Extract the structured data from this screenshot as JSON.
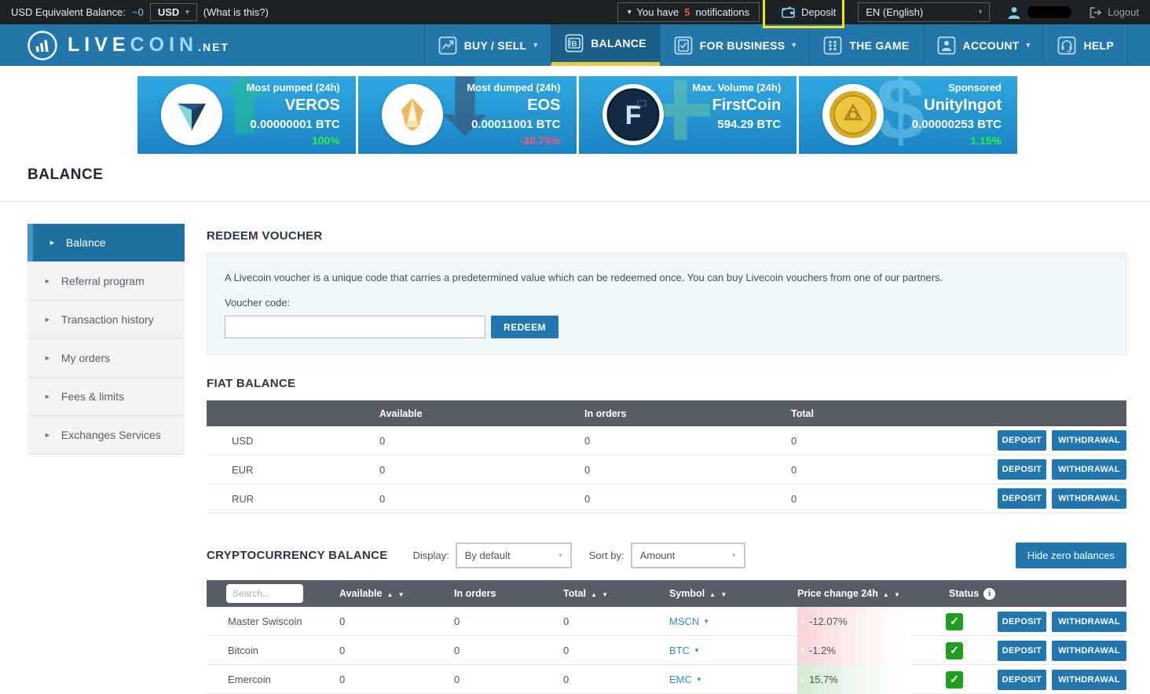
{
  "colors": {
    "topbar_bg": "#1d2124",
    "nav_blue": "#2276a9",
    "nav_active_blue": "#1b5e88",
    "highlight_yellow": "#f2e211",
    "tab_underline_yellow": "#edc73f",
    "accent_button_blue": "#2176ae",
    "table_header_gray": "#565d66",
    "positive_green": "#2bef3e",
    "negative_red": "#f25a75",
    "status_check_green": "#1f9e1f",
    "link_blue": "#2b8fd6"
  },
  "glyphs": {
    "caret_down": "▾",
    "sort_up": "▲",
    "sort_down": "▼",
    "sidebar_arrow": "►",
    "info": "i",
    "check": "✓"
  },
  "top_bar": {
    "balance_label": "USD Equivalent Balance:",
    "balance_value": "~0",
    "currency_select_value": "USD",
    "what_is_this": "(What is this?)",
    "notifications_prefix": "You have",
    "notifications_count": "5",
    "notifications_suffix": "notifications",
    "deposit_label": "Deposit",
    "language_value": "EN (English)",
    "logout_label": "Logout"
  },
  "nav": {
    "logo_live": "LIVE",
    "logo_coin": "COIN",
    "logo_net": ".NET",
    "items": [
      {
        "label": "BUY / SELL",
        "icon": "chart-icon",
        "has_caret": true
      },
      {
        "label": "BALANCE",
        "icon": "wallet-banknote-icon",
        "active": true
      },
      {
        "label": "FOR BUSINESS",
        "icon": "clipboard-check-icon",
        "has_caret": true
      },
      {
        "label": "THE GAME",
        "icon": "grid-dots-icon"
      },
      {
        "label": "ACCOUNT",
        "icon": "user-icon",
        "has_caret": true
      },
      {
        "label": "HELP",
        "icon": "headset-icon"
      }
    ]
  },
  "banner": {
    "cards": [
      {
        "label": "Most pumped (24h)",
        "name": "VEROS",
        "value": "0.00000001 BTC",
        "change": "100%",
        "change_dir": "up",
        "bg_glyph": "⬆",
        "coin_icon": "veros-coin-icon"
      },
      {
        "label": "Most dumped (24h)",
        "name": "EOS",
        "value": "0.00011001 BTC",
        "change": "-38.79%",
        "change_dir": "down",
        "bg_glyph": "⬇",
        "coin_icon": "eos-coin-icon"
      },
      {
        "label": "Max. Volume (24h)",
        "name": "FirstCoin",
        "value": "594.29 BTC",
        "change": "",
        "change_dir": "none",
        "bg_glyph": "+",
        "coin_icon": "firstcoin-coin-icon"
      },
      {
        "label": "Sponsored",
        "name": "UnityIngot",
        "value": "0.00000253 BTC",
        "change": "1.15%",
        "change_dir": "up",
        "bg_glyph": "$",
        "coin_icon": "unityingot-coin-icon"
      }
    ]
  },
  "page_title": "BALANCE",
  "sidebar": {
    "items": [
      {
        "label": "Balance",
        "active": true
      },
      {
        "label": "Referral program"
      },
      {
        "label": "Transaction history"
      },
      {
        "label": "My orders"
      },
      {
        "label": "Fees & limits"
      },
      {
        "label": "Exchanges Services"
      }
    ]
  },
  "voucher": {
    "title": "REDEEM VOUCHER",
    "description": "A Livecoin voucher is a unique code that carries a predetermined value which can be redeemed once. You can buy Livecoin vouchers from one of our partners.",
    "code_label": "Voucher code:",
    "input_value": "",
    "redeem_button": "REDEEM"
  },
  "fiat": {
    "title": "FIAT BALANCE",
    "headers": {
      "available": "Available",
      "in_orders": "In orders",
      "total": "Total"
    },
    "deposit_label": "DEPOSIT",
    "withdrawal_label": "WITHDRAWAL",
    "rows": [
      {
        "currency": "USD",
        "available": "0",
        "in_orders": "0",
        "total": "0"
      },
      {
        "currency": "EUR",
        "available": "0",
        "in_orders": "0",
        "total": "0"
      },
      {
        "currency": "RUR",
        "available": "0",
        "in_orders": "0",
        "total": "0"
      }
    ]
  },
  "crypto": {
    "title": "CRYPTOCURRENCY BALANCE",
    "display_label": "Display:",
    "display_value": "By default",
    "sort_label": "Sort by:",
    "sort_value": "Amount",
    "hide_zero_button": "Hide zero balances",
    "search_placeholder": "Search...",
    "headers": {
      "available": "Available",
      "in_orders": "In orders",
      "total": "Total",
      "symbol": "Symbol",
      "price_change": "Price change 24h",
      "status": "Status"
    },
    "deposit_label": "DEPOSIT",
    "withdrawal_label": "WITHDRAWAL",
    "rows": [
      {
        "name": "Master Swiscoin",
        "available": "0",
        "in_orders": "0",
        "total": "0",
        "symbol": "MSCN",
        "change": "-12.07%",
        "direction": "down",
        "dir_glyph": "▼"
      },
      {
        "name": "Bitcoin",
        "available": "0",
        "in_orders": "0",
        "total": "0",
        "symbol": "BTC",
        "change": "-1.2%",
        "direction": "down",
        "dir_glyph": "▼"
      },
      {
        "name": "Emercoin",
        "available": "0",
        "in_orders": "0",
        "total": "0",
        "symbol": "EMC",
        "change": "15.7%",
        "direction": "up",
        "dir_glyph": "▲"
      }
    ]
  }
}
